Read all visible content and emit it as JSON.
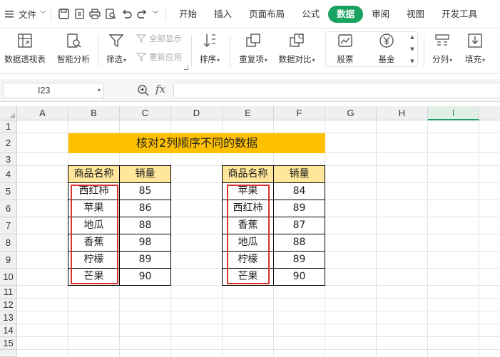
{
  "menubar": {
    "file_label": "文件",
    "tabs": [
      "开始",
      "插入",
      "页面布局",
      "公式",
      "数据",
      "审阅",
      "视图",
      "开发工具"
    ],
    "active_tab": "数据"
  },
  "ribbon": {
    "pivot": "数据透视表",
    "smart_analysis": "智能分析",
    "filter": "筛选",
    "show_all": "全部显示",
    "reapply": "重新应用",
    "sort": "排序",
    "duplicates": "重复项",
    "compare": "数据对比",
    "stocks": "股票",
    "funds": "基金",
    "split": "分列",
    "fill": "填充"
  },
  "formula_bar": {
    "name_box": "I23",
    "fx": "fx",
    "formula": ""
  },
  "sheet": {
    "columns": [
      "A",
      "B",
      "C",
      "D",
      "E",
      "F",
      "G",
      "H",
      "I"
    ],
    "selected_column": "I",
    "rows": [
      "1",
      "2",
      "3",
      "4",
      "5",
      "6",
      "7",
      "8",
      "9",
      "10",
      "11",
      "12",
      "13",
      "14",
      "15"
    ],
    "title": "核对2列顺序不同的数据",
    "left_table": {
      "headers": [
        "商品名称",
        "销量"
      ],
      "rows": [
        [
          "西红柿",
          "85"
        ],
        [
          "苹果",
          "86"
        ],
        [
          "地瓜",
          "88"
        ],
        [
          "香蕉",
          "98"
        ],
        [
          "柠檬",
          "89"
        ],
        [
          "芒果",
          "90"
        ]
      ]
    },
    "right_table": {
      "headers": [
        "商品名称",
        "销量"
      ],
      "rows": [
        [
          "苹果",
          "84"
        ],
        [
          "西红柿",
          "89"
        ],
        [
          "香蕉",
          "87"
        ],
        [
          "地瓜",
          "88"
        ],
        [
          "柠檬",
          "89"
        ],
        [
          "芒果",
          "90"
        ]
      ]
    }
  },
  "colors": {
    "accent": "#1aa260",
    "title_fill": "#ffc000",
    "header_fill": "#ffe69a",
    "highlight_box": "#d9342b"
  }
}
